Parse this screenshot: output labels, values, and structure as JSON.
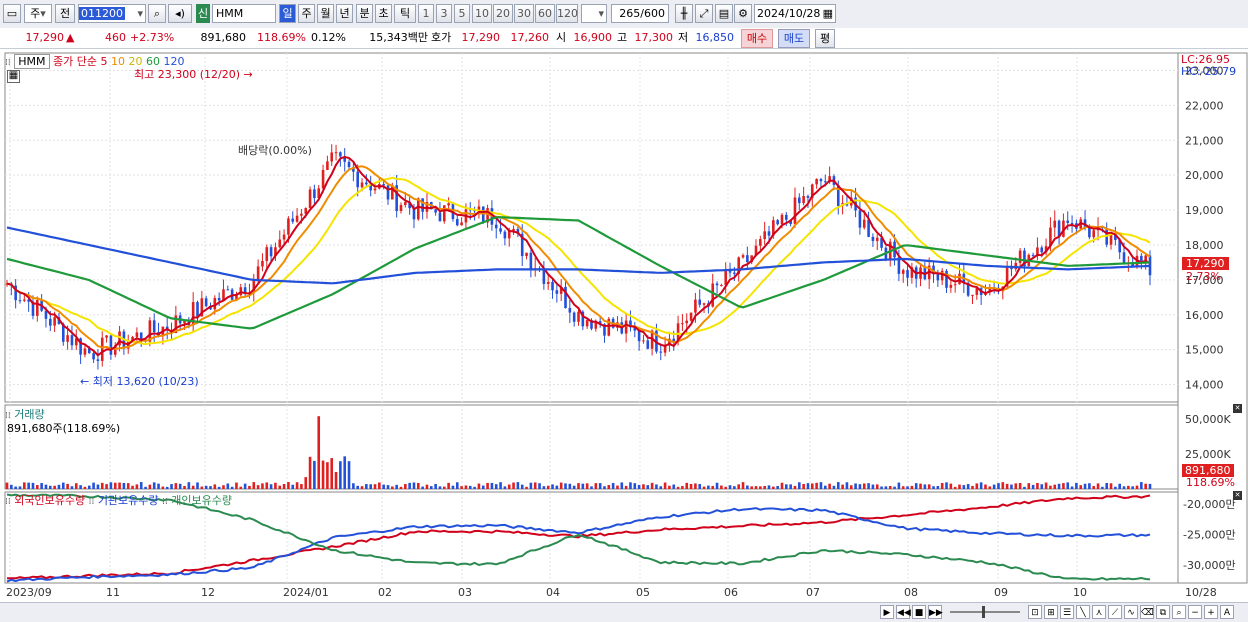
{
  "toolbar": {
    "mode_left": "주",
    "prev_label": "전",
    "code": "011200",
    "stock_badge": "신",
    "stock_name": "HMM",
    "periods": [
      "일",
      "주",
      "월",
      "년",
      "분",
      "초",
      "틱"
    ],
    "active_period": "일",
    "minutes": [
      "1",
      "3",
      "5",
      "10",
      "20",
      "30",
      "60",
      "120"
    ],
    "count_value": "265",
    "count_total": "600",
    "date": "2024/10/28"
  },
  "quote": {
    "price": "17,290",
    "change_arrow": "▲",
    "change": "460",
    "change_pct": "+2.73%",
    "volume": "891,680",
    "volume_ratio": "118.69%",
    "turnover": "0.12%",
    "amount": "15,343백만",
    "bid_label": "호가",
    "ask_price": "17,290",
    "bid_price": "17,260",
    "open_label": "시",
    "open": "16,900",
    "high_label": "고",
    "high": "17,300",
    "low_label": "저",
    "low": "16,850",
    "buy_button": "매수",
    "sell_button": "매도",
    "eval_button": "평"
  },
  "price_chart": {
    "name": "HMM",
    "legend_main": "종가 단순",
    "ma_periods": [
      "5",
      "10",
      "20",
      "60",
      "120"
    ],
    "ma_colors": [
      "#d0021b",
      "#f08c00",
      "#f5e400",
      "#1e9a3a",
      "#2350d8"
    ],
    "high_marker": "최고 23,300 (12/20)",
    "low_marker": "최저 13,620 (10/23)",
    "dividend_label": "배당락(0.00%)",
    "lc": "LC:26.95",
    "hc": "HC:-25.79",
    "last_price_tag": "17,290",
    "last_pct_tag": "2.73%",
    "y_ticks": [
      "23,000",
      "22,000",
      "21,000",
      "20,000",
      "19,000",
      "18,000",
      "17,000",
      "16,000",
      "15,000",
      "14,000"
    ]
  },
  "volume_chart": {
    "title": "거래량",
    "value": "891,680주(118.69%)",
    "y_ticks": [
      "50,000K",
      "25,000K"
    ],
    "last_tag": "891,680",
    "last_pct": "118.69%"
  },
  "holdings_chart": {
    "legend": [
      "외국인보유수량",
      "기관보유수량",
      "개인보유수량"
    ],
    "colors": [
      "#d0021b",
      "#2350d8",
      "#2b8a50"
    ],
    "y_ticks": [
      "-20,000만",
      "-25,000만",
      "-30,000만"
    ]
  },
  "x_axis": {
    "labels": [
      "2023/09",
      "11",
      "12",
      "2024/01",
      "02",
      "03",
      "04",
      "05",
      "06",
      "07",
      "08",
      "09",
      "10",
      "10/28"
    ]
  },
  "chart_data": {
    "type": "line",
    "title": "HMM",
    "xlabel": "",
    "ylabel": "",
    "x": [
      "2023/09",
      "2023/10",
      "2023/11",
      "2023/12",
      "2024/01",
      "2024/02",
      "2024/03",
      "2024/04",
      "2024/05",
      "2024/06",
      "2024/07",
      "2024/08",
      "2024/09",
      "2024/10",
      "2024/10/28"
    ],
    "ylim": [
      13500,
      23500
    ],
    "series": [
      {
        "name": "종가",
        "values": [
          16900,
          14900,
          15700,
          17000,
          20400,
          19000,
          18800,
          16000,
          15200,
          17400,
          19900,
          17300,
          16700,
          18800,
          17290
        ]
      },
      {
        "name": "60",
        "values": [
          17600,
          17000,
          15900,
          15600,
          16600,
          17900,
          18800,
          18700,
          17400,
          16200,
          17000,
          18000,
          17700,
          17400,
          17500
        ]
      },
      {
        "name": "120",
        "values": [
          18500,
          18000,
          17500,
          17000,
          16900,
          17200,
          17300,
          17300,
          17200,
          17300,
          17500,
          17600,
          17400,
          17300,
          17400
        ]
      }
    ],
    "high": {
      "value": 23300,
      "date": "12/20"
    },
    "low": {
      "value": 13620,
      "date": "10/23"
    }
  }
}
